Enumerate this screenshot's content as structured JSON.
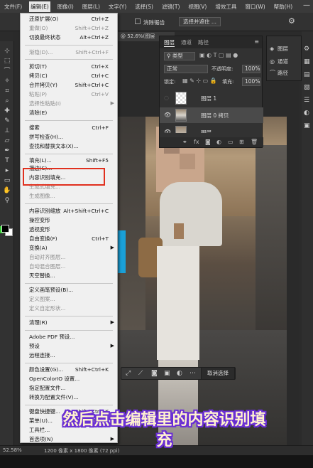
{
  "menubar": {
    "items": [
      "文件(F)",
      "编辑(E)",
      "图像(I)",
      "图层(L)",
      "文字(Y)",
      "选择(S)",
      "滤镜(T)",
      "视图(V)",
      "增效工具",
      "窗口(W)",
      "帮助(H)"
    ],
    "active_index": 1,
    "minimize_icon": "minimize-icon"
  },
  "optbar": {
    "antialias_label": "消除锯齿",
    "select_subject_label": "选择并遮住 ..."
  },
  "document": {
    "tab_title": "@ 52.6%(图层"
  },
  "layers_panel": {
    "tabs": [
      "图层",
      "通道",
      "路径"
    ],
    "kind_select": "类型",
    "blend_mode": "正常",
    "opacity_label": "不透明度:",
    "opacity_value": "100%",
    "lock_label": "锁定:",
    "fill_label": "填充:",
    "fill_value": "100%",
    "layers": [
      {
        "name": "图层 1"
      },
      {
        "name": "图层 0 拷贝"
      },
      {
        "name": "图层"
      }
    ],
    "footer_fx": "fx"
  },
  "right_panel": {
    "items": [
      "图层",
      "通道",
      "路径"
    ]
  },
  "edit_menu": {
    "items": [
      {
        "label": "还原扩展(O)",
        "shortcut": "Ctrl+Z"
      },
      {
        "label": "重做(O)",
        "shortcut": "Shift+Ctrl+Z",
        "disabled": true
      },
      {
        "label": "切换最终状态",
        "shortcut": "Alt+Ctrl+Z"
      },
      {
        "label": "渐隐(D)...",
        "shortcut": "Shift+Ctrl+F",
        "disabled": true
      },
      {
        "label": "剪切(T)",
        "shortcut": "Ctrl+X"
      },
      {
        "label": "拷贝(C)",
        "shortcut": "Ctrl+C"
      },
      {
        "label": "合并拷贝(Y)",
        "shortcut": "Shift+Ctrl+C"
      },
      {
        "label": "粘贴(P)",
        "shortcut": "Ctrl+V",
        "disabled": true
      },
      {
        "label": "选择性粘贴(I)",
        "shortcut": "",
        "disabled": true,
        "submenu": true
      },
      {
        "label": "清除(E)",
        "shortcut": ""
      },
      {
        "label": "搜索",
        "shortcut": "Ctrl+F"
      },
      {
        "label": "拼写检查(H)...",
        "shortcut": ""
      },
      {
        "label": "查找和替换文本(X)...",
        "shortcut": ""
      },
      {
        "label": "填充(L)...",
        "shortcut": "Shift+F5"
      },
      {
        "label": "描边(S)...",
        "shortcut": ""
      },
      {
        "label": "内容识别填充...",
        "shortcut": ""
      },
      {
        "label": "生成式填充...",
        "shortcut": "",
        "disabled": true
      },
      {
        "label": "生成图像...",
        "shortcut": "",
        "disabled": true
      },
      {
        "label": "内容识别缩放",
        "shortcut": "Alt+Shift+Ctrl+C"
      },
      {
        "label": "操控变形",
        "shortcut": ""
      },
      {
        "label": "透视变形",
        "shortcut": ""
      },
      {
        "label": "自由变换(F)",
        "shortcut": "Ctrl+T"
      },
      {
        "label": "变换(A)",
        "shortcut": "",
        "submenu": true
      },
      {
        "label": "自动对齐图层...",
        "shortcut": "",
        "disabled": true
      },
      {
        "label": "自动混合图层...",
        "shortcut": "",
        "disabled": true
      },
      {
        "label": "天空替换...",
        "shortcut": ""
      },
      {
        "label": "定义画笔预设(B)...",
        "shortcut": ""
      },
      {
        "label": "定义图案...",
        "shortcut": "",
        "disabled": true
      },
      {
        "label": "定义自定形状...",
        "shortcut": "",
        "disabled": true
      },
      {
        "label": "清理(R)",
        "shortcut": "",
        "submenu": true
      },
      {
        "label": "Adobe PDF 预设...",
        "shortcut": ""
      },
      {
        "label": "预设",
        "shortcut": "",
        "submenu": true
      },
      {
        "label": "远程连接...",
        "shortcut": ""
      },
      {
        "label": "颜色设置(G)...",
        "shortcut": "Shift+Ctrl+K"
      },
      {
        "label": "OpenColorIO 设置...",
        "shortcut": ""
      },
      {
        "label": "指定配置文件...",
        "shortcut": ""
      },
      {
        "label": "转换为配置文件(V)...",
        "shortcut": ""
      },
      {
        "label": "键盘快捷键...",
        "shortcut": "Alt+Shift+Ctrl+K"
      },
      {
        "label": "菜单(U)...",
        "shortcut": "Alt+Shift+Ctrl+M"
      },
      {
        "label": "工具栏...",
        "shortcut": ""
      },
      {
        "label": "首选项(N)",
        "shortcut": "",
        "submenu": true
      }
    ]
  },
  "context_bar": {
    "deselect_label": "取消选择"
  },
  "statusbar": {
    "zoom": "52.58%",
    "doc_size": "1200 像素 x 1800 像素 (72 ppi)"
  },
  "subtitle": {
    "line1": "然后点击编辑里的内容识别填",
    "line2": "充"
  },
  "colors": {
    "highlight": "#e0301e",
    "subtitle_fill": "#fff2cf",
    "subtitle_stroke": "#6a2fd4"
  }
}
